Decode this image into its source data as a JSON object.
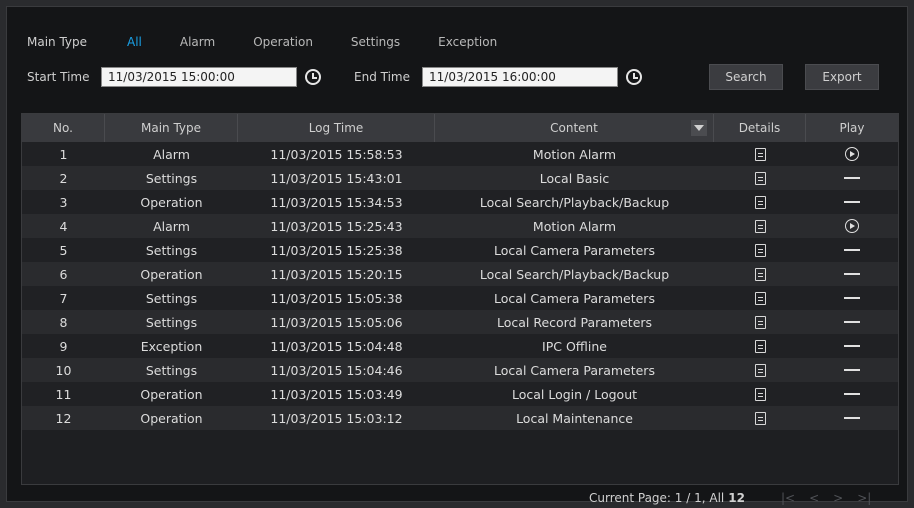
{
  "filter": {
    "label": "Main Type",
    "options": [
      "All",
      "Alarm",
      "Operation",
      "Settings",
      "Exception"
    ],
    "selected": "All"
  },
  "time": {
    "start_label": "Start Time",
    "start_value": "11/03/2015 15:00:00",
    "end_label": "End Time",
    "end_value": "11/03/2015 16:00:00"
  },
  "buttons": {
    "search": "Search",
    "export": "Export"
  },
  "table": {
    "headers": [
      "No.",
      "Main Type",
      "Log Time",
      "Content",
      "Details",
      "Play"
    ],
    "rows": [
      {
        "no": "1",
        "type": "Alarm",
        "time": "11/03/2015 15:58:53",
        "content": "Motion Alarm",
        "play": "play-icon"
      },
      {
        "no": "2",
        "type": "Settings",
        "time": "11/03/2015 15:43:01",
        "content": "Local Basic",
        "play": "dash"
      },
      {
        "no": "3",
        "type": "Operation",
        "time": "11/03/2015 15:34:53",
        "content": "Local Search/Playback/Backup",
        "play": "dash"
      },
      {
        "no": "4",
        "type": "Alarm",
        "time": "11/03/2015 15:25:43",
        "content": "Motion Alarm",
        "play": "play-icon"
      },
      {
        "no": "5",
        "type": "Settings",
        "time": "11/03/2015 15:25:38",
        "content": "Local Camera Parameters",
        "play": "dash"
      },
      {
        "no": "6",
        "type": "Operation",
        "time": "11/03/2015 15:20:15",
        "content": "Local Search/Playback/Backup",
        "play": "dash"
      },
      {
        "no": "7",
        "type": "Settings",
        "time": "11/03/2015 15:05:38",
        "content": "Local Camera Parameters",
        "play": "dash"
      },
      {
        "no": "8",
        "type": "Settings",
        "time": "11/03/2015 15:05:06",
        "content": "Local Record Parameters",
        "play": "dash"
      },
      {
        "no": "9",
        "type": "Exception",
        "time": "11/03/2015 15:04:48",
        "content": "IPC Offline",
        "play": "dash"
      },
      {
        "no": "10",
        "type": "Settings",
        "time": "11/03/2015 15:04:46",
        "content": "Local Camera Parameters",
        "play": "dash"
      },
      {
        "no": "11",
        "type": "Operation",
        "time": "11/03/2015 15:03:49",
        "content": "Local Login / Logout",
        "play": "dash"
      },
      {
        "no": "12",
        "type": "Operation",
        "time": "11/03/2015 15:03:12",
        "content": "Local Maintenance",
        "play": "dash"
      }
    ]
  },
  "footer": {
    "page_text": "Current Page: 1 / 1, All",
    "count": "12"
  },
  "pager": [
    "|<",
    "<",
    ">",
    ">|"
  ],
  "colors": {
    "accent": "#19a0e6",
    "background": "#141517",
    "header": "#393a3e"
  }
}
